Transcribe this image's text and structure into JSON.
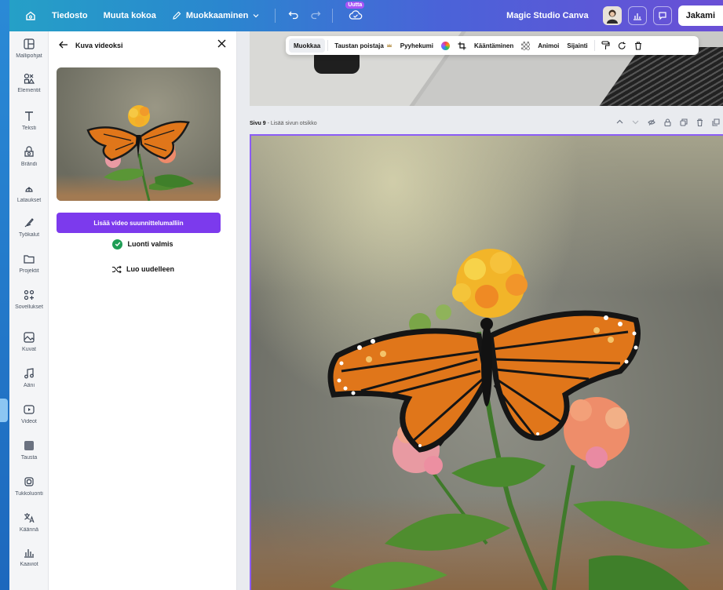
{
  "topbar": {
    "file": "Tiedosto",
    "resize": "Muuta kokoa",
    "editing": "Muokkaaminen",
    "new_badge": "Uutta",
    "magic_studio": "Magic Studio Canva",
    "share": "Jakami"
  },
  "rail": {
    "items": [
      {
        "label": "Mallipohjat",
        "icon": "template-icon"
      },
      {
        "label": "Elementit",
        "icon": "elements-icon"
      },
      {
        "label": "Teksti",
        "icon": "text-icon"
      },
      {
        "label": "Brändi",
        "icon": "brand-icon"
      },
      {
        "label": "Lataukset",
        "icon": "upload-icon"
      },
      {
        "label": "Työkalut",
        "icon": "draw-icon"
      },
      {
        "label": "Projektit",
        "icon": "folder-icon"
      },
      {
        "label": "Sovellukset",
        "icon": "apps-icon"
      },
      {
        "label": "Kuvat",
        "icon": "image-icon"
      },
      {
        "label": "Ääni",
        "icon": "music-icon"
      },
      {
        "label": "Videot",
        "icon": "video-icon"
      },
      {
        "label": "Tausta",
        "icon": "background-icon"
      },
      {
        "label": "Tukkoluonti",
        "icon": "bulk-create-icon"
      },
      {
        "label": "Käännä",
        "icon": "translate-icon"
      },
      {
        "label": "Kaaviot",
        "icon": "chart-icon"
      }
    ]
  },
  "panel": {
    "title": "Kuva videoksi",
    "primary_button": "Lisää video suunnittelumalliin",
    "status": "Luonti valmis",
    "regenerate": "Luo uudelleen"
  },
  "toolbar": {
    "edit": "Muokkaa",
    "bg_remover": "Taustan poistaja",
    "eraser": "Pyyhekumi",
    "flip": "Kääntäminen",
    "animate": "Animoi",
    "position": "Sijainti"
  },
  "page": {
    "label_bold": "Sivu 9",
    "label_rest": " - Lisää sivun otsikko"
  }
}
